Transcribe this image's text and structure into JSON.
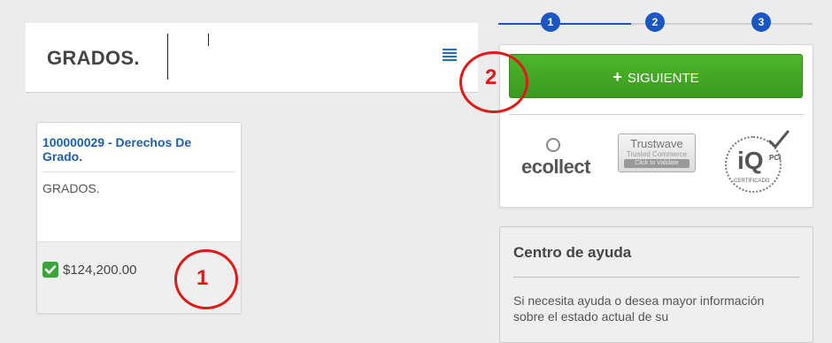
{
  "header": {
    "title": "GRADOS.",
    "list_icon": "list-icon"
  },
  "product": {
    "link": "100000029 - Derechos De Grado.",
    "description": "GRADOS.",
    "price": "$124,200.00",
    "checked": true
  },
  "stepper": {
    "steps": [
      "1",
      "2",
      "3"
    ],
    "current": 1,
    "active_color": "#1a56c4",
    "inactive_color": "#cfcfcf"
  },
  "actions": {
    "next_label": "SIGUIENTE",
    "next_icon": "plus-icon",
    "button_color": "#3fa524"
  },
  "logos": {
    "ecollect": "ecollect",
    "trustwave_name": "Trustwave",
    "trustwave_sub": "Trusted Commerce",
    "trustwave_click": "Click to Validate",
    "iq_text": "iQ",
    "iq_pci": "PCI",
    "iq_cert": "CERTIFICADO"
  },
  "help": {
    "title": "Centro de ayuda",
    "text": "Si necesita ayuda o desea mayor información sobre el estado actual de su"
  },
  "annotations": {
    "marker_1": "1",
    "marker_2": "2",
    "color": "#e01a1a"
  }
}
